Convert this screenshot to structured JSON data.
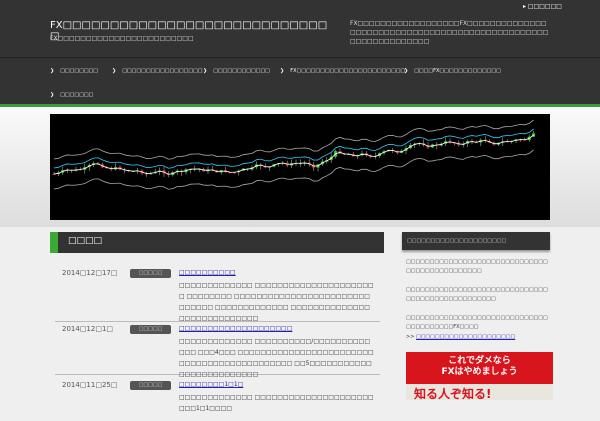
{
  "header": {
    "top_link": "□□□□□□",
    "title": "FX□□□□□□□□□□□□□□□□□□□□□□□□□□□□□",
    "subtitle": "FX□□□□□□□□□□□□□□□□□□□□□□□□",
    "description": "FX□□□□□□□□□□□□□□□□□□FX□□□□□□□□□□□□□□□□□□□□□□□□□□□□□□□□□□□□□□□□□□□□□□□□□□□□□□□□□□□□□□□"
  },
  "nav": [
    "□□□□□□□□",
    "□□□□□□□□□□□□□□□□□",
    "□□□□□□□□□□□□",
    "FX□□□□□□□□□□□□□□□□□□□□□□□",
    "□□□□FX□□□□□□□□□□□□□",
    "□□□□□□□"
  ],
  "main": {
    "heading": "□□□□",
    "posts": [
      {
        "date": "2014□12□17□",
        "category": "□□□□□",
        "title": "□□□□□□□□□□",
        "excerpt": "□□□□□□□□□□□□□ □□□□□□□□□□□□□□□□□□□□□□ □□□□□□□□ □□□□□□□□□□□□□□□□□□□□□□□□□□□□□□ □□□□□□□□□□□□□ □□□□□□□□□□□□□□□□□□□□□□□□□□□□"
      },
      {
        "date": "2014□12□1□",
        "category": "□□□□□",
        "title": "□□□□□□□□□□□□□□□□□□□□",
        "excerpt": "□□□□□□□□□□□□□ □□□□□□□□□□/□□□□□□□□□□□□□ □□□4□□□ □□□□□□□□□□□□□□□□□□□□□□□□□□□□□□□□□□□□□□□□□□□□ □□5□□□□□□□□□□□□□□□□□□□□□□□□□"
      },
      {
        "date": "2014□11□25□",
        "category": "□□□□□",
        "title": "□□□□□□□□1□1□",
        "excerpt": "□□□□□□□□□□□□□ □□□□□□□□□□□□□□□□□□□□□□□□1□1□□□□"
      }
    ]
  },
  "sidebar": {
    "heading": "□□□□□□□□□□□□□□□□□□□□□",
    "paragraphs": [
      "□□□□□□□□□□□□□□□□□□□□□□□□□□□□□□□□□□□□□□□□□□□□□□",
      "□□□□□□□□□□□□□□□□□□□□□□□□□□□□□□□□□□□□□□□□□□□□□□□□□",
      "□□□□□□□□□□□□□□□□□□□□□□□□□□□□□□□□□□□□□□□□FX□□□□"
    ],
    "link_prefix": ">>",
    "link": "□□□□□□□□□□□□□□□□□□□□□",
    "ad_line1": "これでダメなら",
    "ad_line2": "FXはやめましょう",
    "ad_line3": "知る人ぞ知る!"
  }
}
